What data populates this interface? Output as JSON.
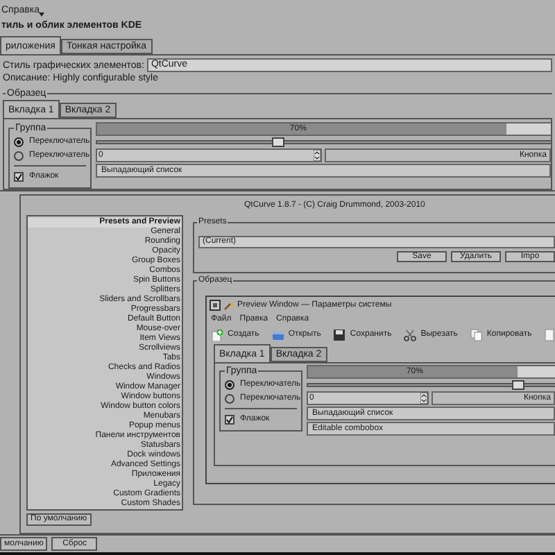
{
  "menu": {
    "label": "Справка"
  },
  "title": "тиль и облик элементов KDE",
  "tabs": [
    {
      "label": "риложения",
      "selected": true
    },
    {
      "label": "Тонкая настройка",
      "selected": false
    }
  ],
  "style_field": {
    "label": "Стиль графических элементов:",
    "value": "QtCurve"
  },
  "description": "Описание: Highly configurable style",
  "sample": {
    "legend": "Образец",
    "tabs": [
      {
        "label": "Вкладка 1",
        "selected": true
      },
      {
        "label": "Вкладка 2",
        "selected": false
      }
    ],
    "group": "Группа",
    "radios": [
      {
        "label": "Переключатель",
        "selected": true
      },
      {
        "label": "Переключатель",
        "selected": false
      }
    ],
    "checkbox": {
      "label": "Флажок",
      "checked": true
    },
    "progress": {
      "level": 0.7,
      "reading": "70%"
    },
    "slider": {
      "level": 0.31
    },
    "spin_value": "0",
    "button": "Кнопка",
    "combo": "Выпадающий список"
  },
  "dialog": {
    "header": "QtCurve 1.8.7 - (C) Craig Drummond, 2003-2010",
    "sections": [
      {
        "label": "Presets and Preview",
        "selected": true
      },
      {
        "label": "General",
        "selected": false
      },
      {
        "label": "Rounding",
        "selected": false
      },
      {
        "label": "Opacity",
        "selected": false
      },
      {
        "label": "Group Boxes",
        "selected": false
      },
      {
        "label": "Combos",
        "selected": false
      },
      {
        "label": "Spin Buttons",
        "selected": false
      },
      {
        "label": "Splitters",
        "selected": false
      },
      {
        "label": "Sliders and Scrollbars",
        "selected": false
      },
      {
        "label": "Progressbars",
        "selected": false
      },
      {
        "label": "Default Button",
        "selected": false
      },
      {
        "label": "Mouse-over",
        "selected": false
      },
      {
        "label": "Item Views",
        "selected": false
      },
      {
        "label": "Scrollviews",
        "selected": false
      },
      {
        "label": "Tabs",
        "selected": false
      },
      {
        "label": "Checks and Radios",
        "selected": false
      },
      {
        "label": "Windows",
        "selected": false
      },
      {
        "label": "Window Manager",
        "selected": false
      },
      {
        "label": "Window buttons",
        "selected": false
      },
      {
        "label": "Window button colors",
        "selected": false
      },
      {
        "label": "Menubars",
        "selected": false
      },
      {
        "label": "Popup menus",
        "selected": false
      },
      {
        "label": "Панели инструментов",
        "selected": false
      },
      {
        "label": "Statusbars",
        "selected": false
      },
      {
        "label": "Dock windows",
        "selected": false
      },
      {
        "label": "Advanced Settings",
        "selected": false
      },
      {
        "label": "Приложения",
        "selected": false
      },
      {
        "label": "Legacy",
        "selected": false
      },
      {
        "label": "Custom Gradients",
        "selected": false
      },
      {
        "label": "Custom Shades",
        "selected": false
      }
    ],
    "defaults_button": "По умолчанию",
    "presets": {
      "legend": "Presets",
      "value": "(Current)",
      "buttons": [
        "Save",
        "Удалить",
        "Impo"
      ]
    },
    "preview": {
      "legend": "Образец",
      "window_title": "Preview Window — Параметры системы",
      "menu": [
        "Файл",
        "Правка",
        "Справка"
      ],
      "toolbar": [
        {
          "kind": "new",
          "label": "Создать"
        },
        {
          "kind": "open",
          "label": "Открыть"
        },
        {
          "kind": "save",
          "label": "Сохранить"
        },
        {
          "kind": "cut",
          "label": "Вырезать"
        },
        {
          "kind": "copy",
          "label": "Копировать"
        },
        {
          "kind": "paste"
        }
      ],
      "tabs": [
        {
          "label": "Вкладка 1",
          "selected": true
        },
        {
          "label": "Вкладка 2",
          "selected": false
        }
      ],
      "group": "Группа",
      "radios": [
        {
          "label": "Переключатель",
          "selected": true
        },
        {
          "label": "Переключатель",
          "selected": false
        }
      ],
      "checkbox": {
        "label": "Флажок",
        "checked": true
      },
      "progress": {
        "level": 0.7,
        "reading": "70%"
      },
      "slider": {
        "level": 0.7
      },
      "spin_value": "0",
      "button": "Кнопка",
      "combo": "Выпадающий список",
      "editable_combo": "Editable combobox"
    }
  },
  "bottom_buttons": [
    "молчанию",
    "Сброс"
  ]
}
